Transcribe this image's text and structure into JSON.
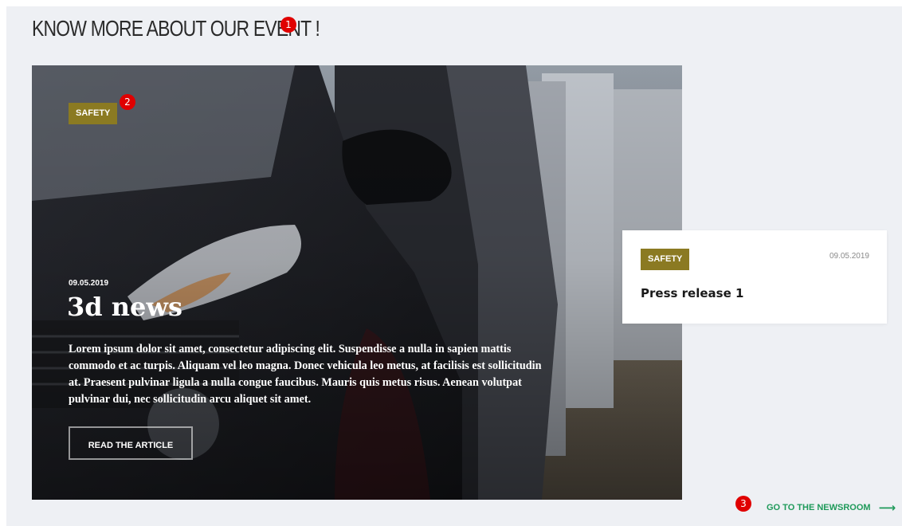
{
  "section": {
    "heading": "KNOW MORE ABOUT OUR EVENT !"
  },
  "markers": [
    "1",
    "2",
    "3"
  ],
  "hero": {
    "tag": "SAFETY",
    "date": "09.05.2019",
    "title": "3d news",
    "body": "Lorem ipsum dolor sit amet, consectetur adipiscing elit. Suspendisse a nulla in sapien mattis commodo et ac turpis. Aliquam vel leo magna. Donec vehicula leo metus, at facilisis est sollicitudin at. Praesent pulvinar ligula a nulla congue faucibus. Mauris quis metus risus. Aenean volutpat pulvinar dui, nec sollicitudin arcu aliquet sit amet.",
    "button_label": "READ THE ARTICLE",
    "image_icon": "parked-cars-photo"
  },
  "card": {
    "tag": "SAFETY",
    "date": "09.05.2019",
    "title": "Press release 1"
  },
  "footer": {
    "newsroom_label": "GO TO THE NEWSROOM",
    "arrow_icon": "arrow-right-icon"
  },
  "colors": {
    "tag_bg": "#8b7a22",
    "link_green": "#1f9a5a",
    "marker_red": "#e00000",
    "panel_bg": "#eef0f4"
  }
}
